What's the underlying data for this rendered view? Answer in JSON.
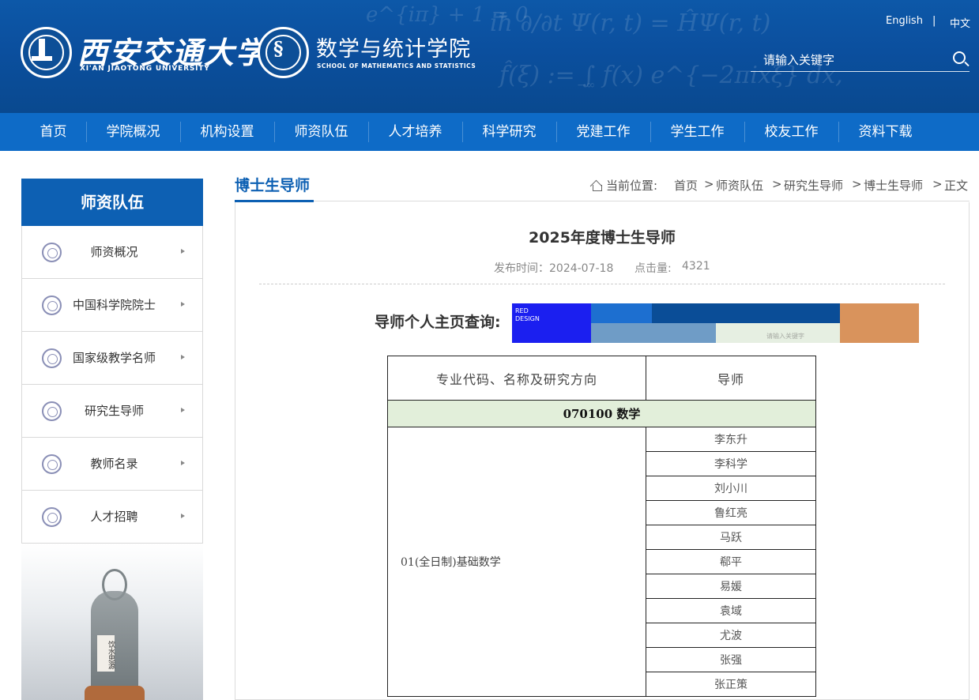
{
  "header": {
    "formulas": [
      "e^{iπ} + 1 = 0",
      "iħ ∂/∂t Ψ(r, t) = ĤΨ(r, t)",
      "f̂(ξ) := ∫ f(x) e^{−2πixξ} dx,",
      "−∞"
    ],
    "university_name": "西安交通大学",
    "university_en": "XI'AN JIAOTONG UNIVERSITY",
    "school_name": "数学与统计学院",
    "school_en": "SCHOOL OF MATHEMATICS AND STATISTICS",
    "lang_en": "English",
    "lang_sep": "|",
    "lang_cn": "中文",
    "search_placeholder": "请输入关键字",
    "brand_color": "#0b4f9e"
  },
  "nav": {
    "items": [
      "首页",
      "学院概况",
      "机构设置",
      "师资队伍",
      "人才培养",
      "科学研究",
      "党建工作",
      "学生工作",
      "校友工作",
      "资料下载"
    ],
    "color": "#0e6bc7"
  },
  "sidebar": {
    "title": "师资队伍",
    "items": [
      "师资概况",
      "中国科学院院士",
      "国家级教学名师",
      "研究生导师",
      "教师名录",
      "人才招聘"
    ],
    "photo_plaque": "饮水思源"
  },
  "main": {
    "section_title": "博士生导师",
    "breadcrumb": {
      "prefix": "当前位置:",
      "items": [
        "首页",
        "师资队伍",
        "研究生导师",
        "博士生导师",
        "正文"
      ],
      "sep": ">"
    },
    "article": {
      "title": "2025年度博士生导师",
      "publish_label": "发布时间：2024-07-18",
      "views_label": "点击量:",
      "views": "4321"
    },
    "query_label": "导师个人主页查询:",
    "banner": {
      "line1": "RED",
      "line2": "DESIGN"
    },
    "table": {
      "headers": [
        "专业代码、名称及研究方向",
        "导师"
      ],
      "subject": "070100  数学",
      "direction": "01(全日制)基础数学",
      "tutors": [
        "李东升",
        "李科学",
        "刘小川",
        "鲁红亮",
        "马跃",
        "郗平",
        "易媛",
        "袁域",
        "尤波",
        "张强",
        "张正策"
      ]
    }
  }
}
